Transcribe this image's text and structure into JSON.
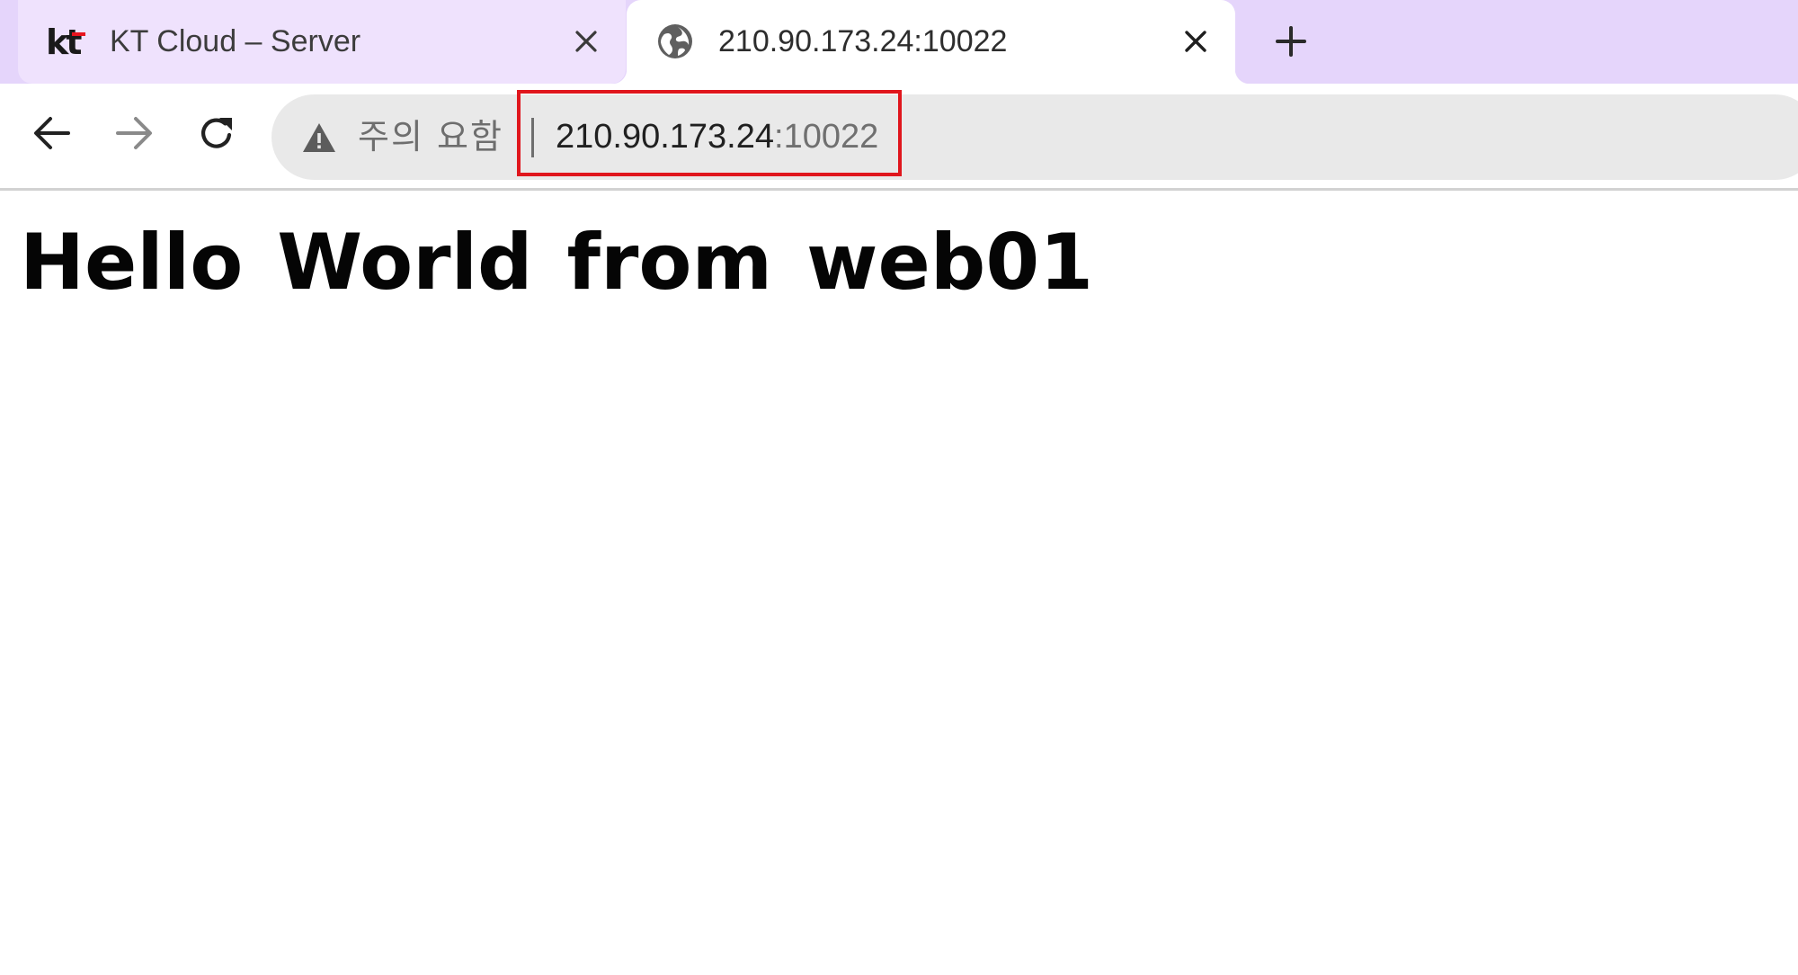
{
  "tabs": [
    {
      "title": "KT Cloud – Server",
      "favicon": "kt-logo-icon",
      "favicon_text": "kt",
      "active": false
    },
    {
      "title": "210.90.173.24:10022",
      "favicon": "globe-icon",
      "active": true
    }
  ],
  "toolbar": {
    "back_icon": "arrow-left-icon",
    "forward_icon": "arrow-right-icon",
    "reload_icon": "reload-icon"
  },
  "address_bar": {
    "security_icon": "warning-triangle-icon",
    "security_label": "주의 요함",
    "url_host": "210.90.173.24",
    "url_port": ":10022"
  },
  "page": {
    "heading": "Hello World from web01"
  },
  "colors": {
    "tabstrip": "#e5d5fb",
    "inactive_tab": "#efe2fd",
    "omnibox": "#e9e9e9",
    "highlight": "#e0161d",
    "kt_red": "#e8141e"
  }
}
